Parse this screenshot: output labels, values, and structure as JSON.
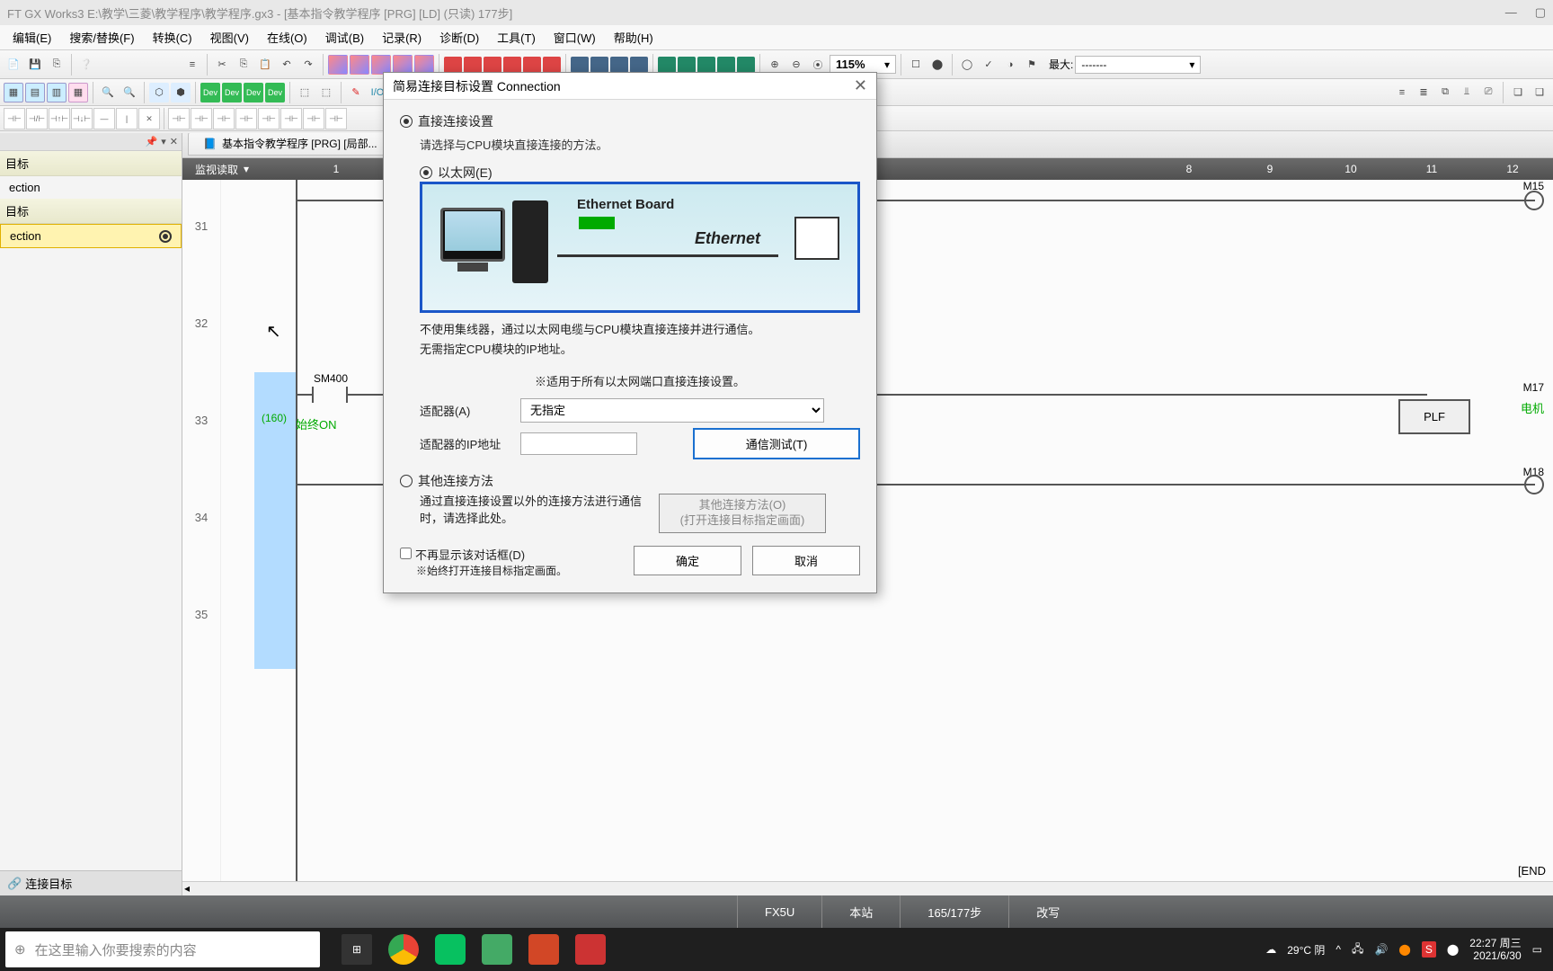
{
  "window": {
    "title": "FT GX Works3 E:\\教学\\三菱\\教学程序\\教学程序.gx3 - [基本指令教学程序 [PRG] [LD] (只读) 177步]"
  },
  "menu": {
    "edit": "编辑(E)",
    "find": "搜索/替换(F)",
    "convert": "转换(C)",
    "view": "视图(V)",
    "online": "在线(O)",
    "debug": "调试(B)",
    "record": "记录(R)",
    "diagnose": "诊断(D)",
    "tool": "工具(T)",
    "window": "窗口(W)",
    "help": "帮助(H)"
  },
  "toolbar": {
    "zoom": "115%",
    "max_label": "最大:",
    "max_value": "-------"
  },
  "left_panel": {
    "group1": "目标",
    "item1": "ection",
    "group2": "目标",
    "item2": "ection",
    "bottom": "连接目标"
  },
  "editor": {
    "tab": "基本指令教学程序 [PRG] [局部...",
    "monitor_btn": "监视读取",
    "cols": [
      "1",
      "8",
      "9",
      "10",
      "11",
      "12"
    ],
    "rows": [
      "31",
      "32",
      "33",
      "34",
      "35"
    ],
    "sm400": "SM400",
    "step160": "(160)",
    "always_on": "始终ON",
    "m15": "M15",
    "m17": "M17",
    "m18": "M18",
    "plf": "PLF",
    "motor": "电机",
    "end": "[END"
  },
  "dialog": {
    "title": "简易连接目标设置 Connection",
    "direct_radio": "直接连接设置",
    "direct_note": "请选择与CPU模块直接连接的方法。",
    "eth_radio": "以太网(E)",
    "eth_board": "Ethernet Board",
    "eth_label": "Ethernet",
    "note1": "不使用集线器，通过以太网电缆与CPU模块直接连接并进行通信。",
    "note2": "无需指定CPU模块的IP地址。",
    "note3": "※适用于所有以太网端口直接连接设置。",
    "adapter_label": "适配器(A)",
    "adapter_value": "无指定",
    "ip_label": "适配器的IP地址",
    "comm_test": "通信测试(T)",
    "other_radio": "其他连接方法",
    "other_note": "通过直接连接设置以外的连接方法进行通信时，请选择此处。",
    "other_btn1": "其他连接方法(O)",
    "other_btn2": "(打开连接目标指定画面)",
    "dont_show": "不再显示该对话框(D)",
    "dont_show_note": "※始终打开连接目标指定画面。",
    "ok": "确定",
    "cancel": "取消"
  },
  "status": {
    "plc": "FX5U",
    "station": "本站",
    "steps": "165/177步",
    "mode": "改写"
  },
  "taskbar": {
    "search_placeholder": "在这里输入你要搜索的内容",
    "weather": "29°C 阴",
    "time": "22:27 周三",
    "date": "2021/6/30"
  }
}
